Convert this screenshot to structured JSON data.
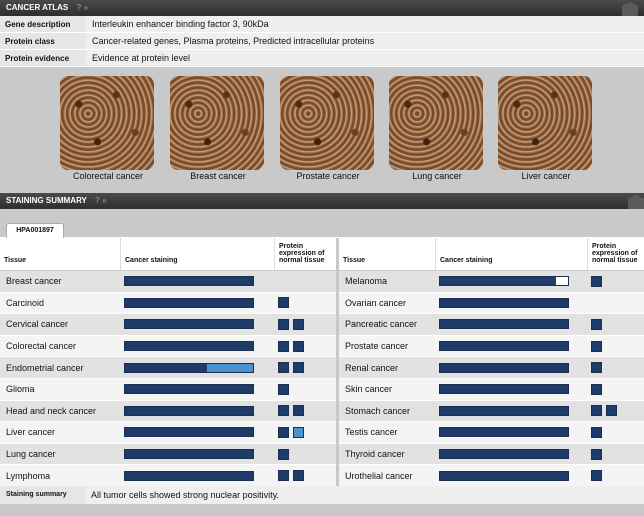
{
  "cancer_atlas": {
    "title": "CANCER ATLAS",
    "help": "? »",
    "rows": [
      {
        "label": "Gene description",
        "value": "Interleukin enhancer binding factor 3, 90kDa"
      },
      {
        "label": "Protein class",
        "value": "Cancer-related genes, Plasma proteins, Predicted intracellular proteins"
      },
      {
        "label": "Protein evidence",
        "value": "Evidence at protein level"
      }
    ],
    "thumbnails": [
      "Colorectal cancer",
      "Breast cancer",
      "Prostate cancer",
      "Lung cancer",
      "Liver cancer"
    ]
  },
  "staining_summary": {
    "title": "STAINING SUMMARY",
    "help": "? »",
    "tab": "HPA001897",
    "columns": {
      "tissue": "Tissue",
      "cancer": "Cancer staining",
      "normal": "Protein expression of normal tissue"
    },
    "colors": {
      "strong": "#1f3b6a",
      "medium": "#4a93cf",
      "empty": "#ffffff"
    },
    "left": [
      {
        "tissue": "Breast cancer",
        "strong": 1.0,
        "medium": 0.0,
        "normal": []
      },
      {
        "tissue": "Carcinoid",
        "strong": 1.0,
        "medium": 0.0,
        "normal": [
          "strong"
        ]
      },
      {
        "tissue": "Cervical cancer",
        "strong": 1.0,
        "medium": 0.0,
        "normal": [
          "strong",
          "strong"
        ]
      },
      {
        "tissue": "Colorectal cancer",
        "strong": 1.0,
        "medium": 0.0,
        "normal": [
          "strong",
          "strong"
        ]
      },
      {
        "tissue": "Endometrial cancer",
        "strong": 0.64,
        "medium": 0.36,
        "normal": [
          "strong",
          "strong"
        ]
      },
      {
        "tissue": "Glioma",
        "strong": 1.0,
        "medium": 0.0,
        "normal": [
          "strong"
        ]
      },
      {
        "tissue": "Head and neck cancer",
        "strong": 1.0,
        "medium": 0.0,
        "normal": [
          "strong",
          "strong"
        ]
      },
      {
        "tissue": "Liver cancer",
        "strong": 1.0,
        "medium": 0.0,
        "normal": [
          "strong",
          "medium"
        ]
      },
      {
        "tissue": "Lung cancer",
        "strong": 1.0,
        "medium": 0.0,
        "normal": [
          "strong"
        ]
      },
      {
        "tissue": "Lymphoma",
        "strong": 1.0,
        "medium": 0.0,
        "normal": [
          "strong",
          "strong"
        ]
      }
    ],
    "right": [
      {
        "tissue": "Melanoma",
        "strong": 0.91,
        "medium": 0.0,
        "normal": [
          "strong"
        ]
      },
      {
        "tissue": "Ovarian cancer",
        "strong": 1.0,
        "medium": 0.0,
        "normal": []
      },
      {
        "tissue": "Pancreatic cancer",
        "strong": 1.0,
        "medium": 0.0,
        "normal": [
          "strong"
        ]
      },
      {
        "tissue": "Prostate cancer",
        "strong": 1.0,
        "medium": 0.0,
        "normal": [
          "strong"
        ]
      },
      {
        "tissue": "Renal cancer",
        "strong": 1.0,
        "medium": 0.0,
        "normal": [
          "strong"
        ]
      },
      {
        "tissue": "Skin cancer",
        "strong": 1.0,
        "medium": 0.0,
        "normal": [
          "strong"
        ]
      },
      {
        "tissue": "Stomach cancer",
        "strong": 1.0,
        "medium": 0.0,
        "normal": [
          "strong",
          "strong"
        ]
      },
      {
        "tissue": "Testis cancer",
        "strong": 1.0,
        "medium": 0.0,
        "normal": [
          "strong"
        ]
      },
      {
        "tissue": "Thyroid cancer",
        "strong": 1.0,
        "medium": 0.0,
        "normal": [
          "strong"
        ]
      },
      {
        "tissue": "Urothelial cancer",
        "strong": 1.0,
        "medium": 0.0,
        "normal": [
          "strong"
        ]
      }
    ],
    "summary_label": "Staining summary",
    "summary_value": "All tumor cells showed strong nuclear positivity."
  }
}
